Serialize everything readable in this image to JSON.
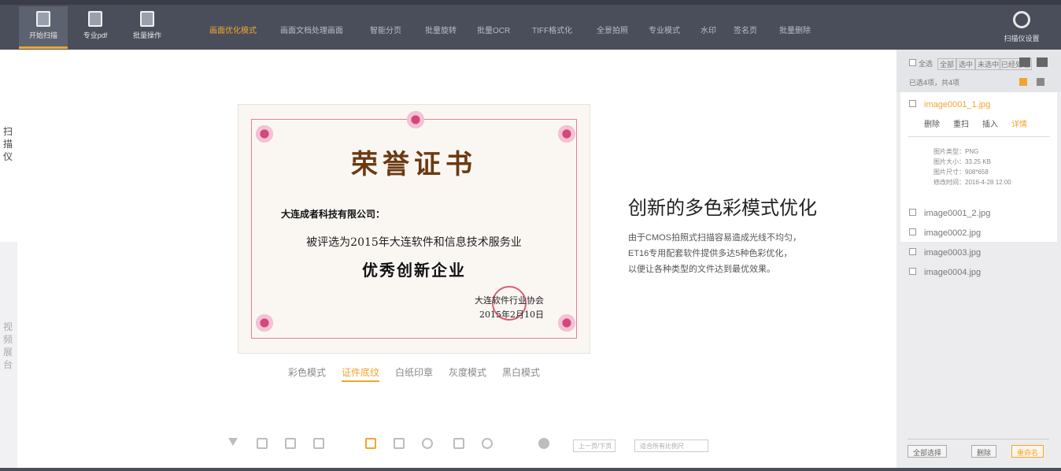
{
  "toolbar": {
    "tools": [
      {
        "label": "开始扫描",
        "active": true
      },
      {
        "label": "专业pdf",
        "active": false
      },
      {
        "label": "批量操作",
        "active": false
      }
    ],
    "nav": [
      {
        "label": "画面优化模式",
        "active": true
      },
      {
        "label": "画面文档处理画面",
        "active": false
      },
      {
        "label": "智能分页",
        "active": false
      },
      {
        "label": "批量旋转",
        "active": false
      },
      {
        "label": "批量OCR",
        "active": false
      },
      {
        "label": "TIFF格式化",
        "active": false
      },
      {
        "label": "全景拍照",
        "active": false
      },
      {
        "label": "专业模式",
        "active": false
      },
      {
        "label": "水印",
        "active": false
      },
      {
        "label": "签名页",
        "active": false
      },
      {
        "label": "批量删除",
        "active": false
      }
    ],
    "settings_label": "扫描仪设置"
  },
  "leftbar": {
    "label": "扫描仪",
    "secondary_label": "视频展台"
  },
  "certificate": {
    "title": "荣誉证书",
    "recipient": "大连成者科技有限公司：",
    "line1": "被评选为2015年大连软件和信息技术服务业",
    "line2": "优秀创新企业",
    "issuer": "大连软件行业协会",
    "date": "2015年2月10日"
  },
  "modes": {
    "items": [
      {
        "label": "彩色模式",
        "active": false
      },
      {
        "label": "证件底纹",
        "active": true
      },
      {
        "label": "白纸印章",
        "active": false
      },
      {
        "label": "灰度模式",
        "active": false
      },
      {
        "label": "黑白模式",
        "active": false
      }
    ]
  },
  "feature": {
    "title": "创新的多色彩模式优化",
    "description_lines": [
      "由于CMOS拍照式扫描容易造成光线不均匀，",
      "ET16专用配套软件提供多达5种色彩优化，",
      "以便让各种类型的文件达到最优效果。"
    ]
  },
  "bottom_toolbar": {
    "page_select": "上一页/下页",
    "zoom_select": "适合所有比例尺"
  },
  "right_panel": {
    "header": {
      "select_all": "全选",
      "filters": [
        "全部",
        "选中",
        "未选中",
        "已经处理"
      ],
      "count_text": "已选4项，共4项"
    },
    "files": [
      {
        "name": "image0001_1.jpg",
        "active": true,
        "checked": true
      },
      {
        "name": "image0001_2.jpg",
        "active": false,
        "checked": true
      },
      {
        "name": "image0002.jpg",
        "active": false,
        "checked": false
      },
      {
        "name": "image0003.jpg",
        "active": false,
        "checked": false
      },
      {
        "name": "image0004.jpg",
        "active": false,
        "checked": false
      }
    ],
    "selected_actions": [
      {
        "label": "删除",
        "orange": false
      },
      {
        "label": "重扫",
        "orange": false
      },
      {
        "label": "插入",
        "orange": false
      },
      {
        "label": "详情",
        "orange": true
      }
    ],
    "meta": [
      "图片类型：PNG",
      "图片大小：33.25 KB",
      "图片尺寸：908*658",
      "修改时间：2016-4-28  12:00"
    ],
    "footer_buttons": [
      {
        "label": "全部选择",
        "orange": false
      },
      {
        "label": "删除",
        "orange": false
      },
      {
        "label": "重命名",
        "orange": true
      }
    ]
  },
  "colors": {
    "toolbar_bg": "#4a4e5a",
    "accent": "#f0a531",
    "panel_bg": "#ececee"
  }
}
